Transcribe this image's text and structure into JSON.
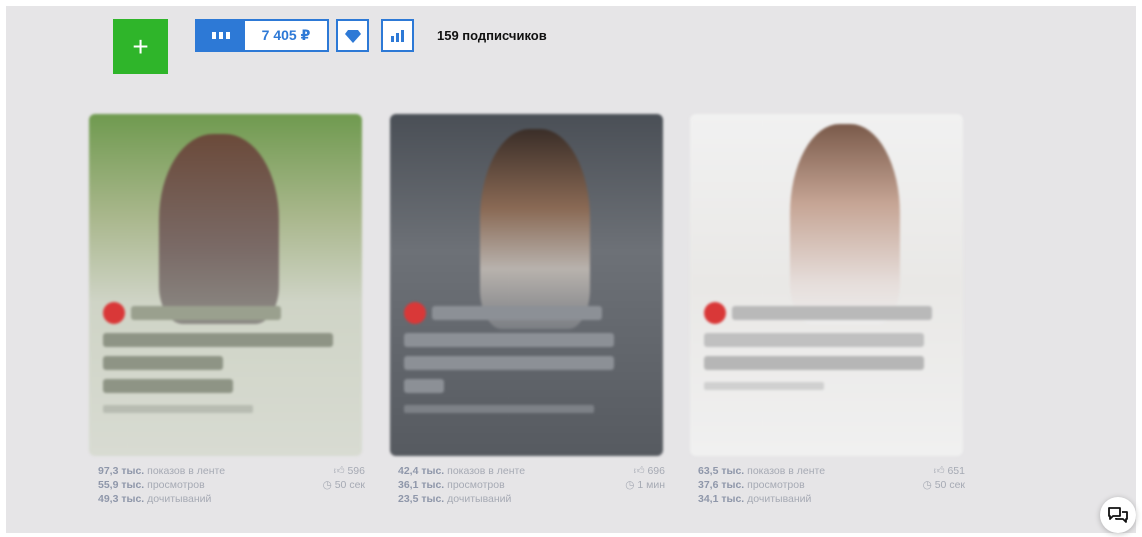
{
  "toolbar": {
    "add_label": "+",
    "balance_amount": "7 405 ₽",
    "subscribers": "159 подписчиков"
  },
  "colors": {
    "accent_blue": "#2d79d6",
    "add_green": "#2fb52a",
    "background": "#e6e5e7"
  },
  "icons": [
    "plus-icon",
    "bars-icon",
    "diamond-icon",
    "bar-chart-icon",
    "like-icon",
    "clock-icon",
    "chat-bubbles-icon"
  ],
  "cards": [
    {
      "stats": {
        "impressions_value": "97,3 тыс.",
        "impressions_label": "показов в ленте",
        "views_value": "55,9 тыс.",
        "views_label": "просмотров",
        "reads_value": "49,3 тыс.",
        "reads_label": "дочитываний",
        "likes": "596",
        "time": "50 сек"
      }
    },
    {
      "stats": {
        "impressions_value": "42,4 тыс.",
        "impressions_label": "показов в ленте",
        "views_value": "36,1 тыс.",
        "views_label": "просмотров",
        "reads_value": "23,5 тыс.",
        "reads_label": "дочитываний",
        "likes": "696",
        "time": "1 мин"
      }
    },
    {
      "stats": {
        "impressions_value": "63,5 тыс.",
        "impressions_label": "показов в ленте",
        "views_value": "37,6 тыс.",
        "views_label": "просмотров",
        "reads_value": "34,1 тыс.",
        "reads_label": "дочитываний",
        "likes": "651",
        "time": "50 сек"
      }
    }
  ]
}
